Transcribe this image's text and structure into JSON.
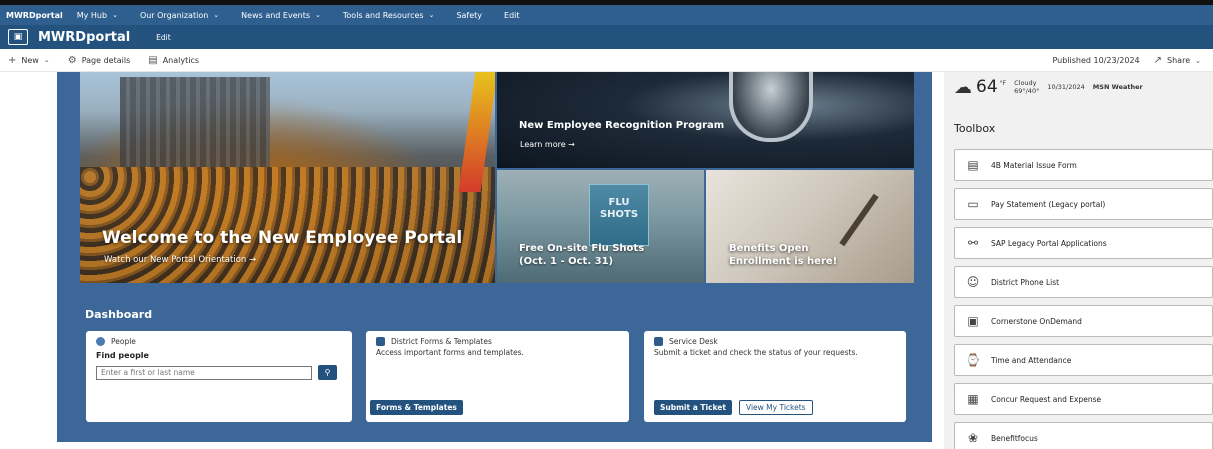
{
  "hubnav": {
    "brand": "MWRDportal",
    "items": [
      {
        "label": "My Hub",
        "has_chevron": true
      },
      {
        "label": "Our Organization",
        "has_chevron": true
      },
      {
        "label": "News and Events",
        "has_chevron": true
      },
      {
        "label": "Tools and Resources",
        "has_chevron": true
      },
      {
        "label": "Safety",
        "has_chevron": false
      },
      {
        "label": "Edit",
        "has_chevron": false
      }
    ]
  },
  "site_header": {
    "title": "MWRDportal",
    "edit_label": "Edit",
    "icon": "site-logo-icon"
  },
  "command_bar": {
    "new_label": "New",
    "page_details_label": "Page details",
    "analytics_label": "Analytics",
    "published_label": "Published 10/23/2024",
    "share_label": "Share"
  },
  "hero": {
    "title": "Welcome to the New Employee Portal",
    "link": "Watch our New Portal Orientation →"
  },
  "tiles": {
    "recognition": {
      "title": "New Employee Recognition Program",
      "link": "Learn more →"
    },
    "flu": {
      "title_line1": "Free On-site Flu Shots",
      "title_line2": "(Oct. 1 - Oct. 31)",
      "sign_line1": "FLU",
      "sign_line2": "SHOTS"
    },
    "benefits": {
      "title_line1": "Benefits Open",
      "title_line2": "Enrollment is here!"
    }
  },
  "dashboard": {
    "title": "Dashboard",
    "people": {
      "title": "People",
      "find_label": "Find people",
      "search_placeholder": "Enter a first or last name"
    },
    "forms": {
      "title": "District Forms & Templates",
      "description": "Access important forms and templates.",
      "button": "Forms & Templates"
    },
    "service_desk": {
      "title": "Service Desk",
      "description": "Submit a ticket and check the status of your requests.",
      "submit_button": "Submit a Ticket",
      "view_button": "View My Tickets"
    }
  },
  "weather": {
    "temperature": "64",
    "unit": "°F",
    "condition": "Cloudy",
    "hi_lo": "69°/40°",
    "date": "10/31/2024",
    "source": "MSN Weather"
  },
  "toolbox": {
    "title": "Toolbox",
    "items": [
      {
        "label": "4B Material Issue Form",
        "icon": "form-icon"
      },
      {
        "label": "Pay Statement (Legacy portal)",
        "icon": "money-icon"
      },
      {
        "label": "SAP Legacy Portal Applications",
        "icon": "link-icon"
      },
      {
        "label": "District Phone List",
        "icon": "people-icon"
      },
      {
        "label": "Cornerstone OnDemand",
        "icon": "training-icon"
      },
      {
        "label": "Time and Attendance",
        "icon": "clock-icon"
      },
      {
        "label": "Concur Request and Expense",
        "icon": "receipt-icon"
      },
      {
        "label": "Benefitfocus",
        "icon": "handshake-icon"
      }
    ]
  },
  "colors": {
    "hubnav_bg": "#2f5f8f",
    "header_bg": "#23527f",
    "canvas_bg": "#3c6798",
    "accent": "#23527f"
  }
}
